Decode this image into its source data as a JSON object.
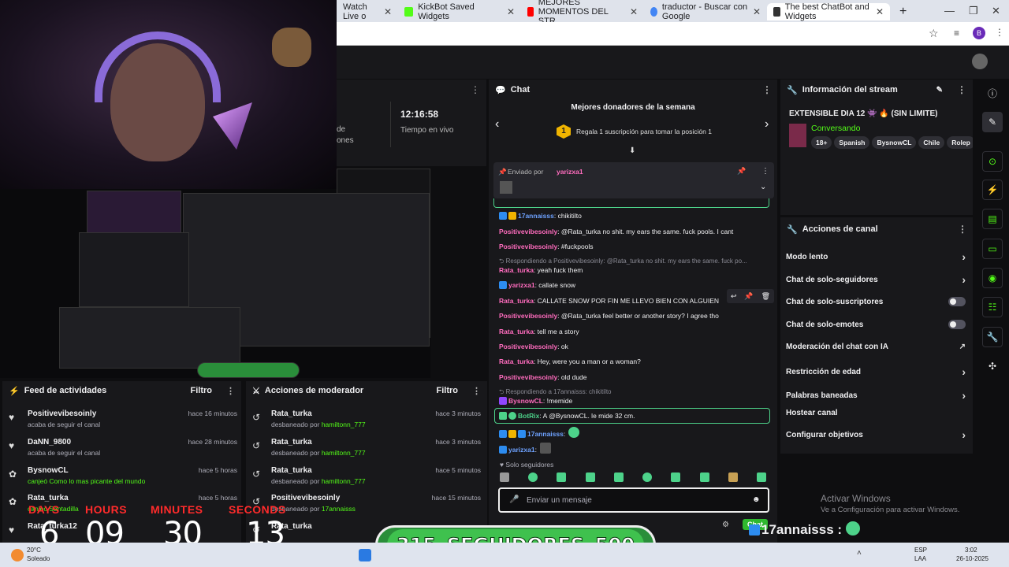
{
  "browser": {
    "tabs": [
      {
        "label": "Watch Live o",
        "color": "#9146ff"
      },
      {
        "label": "KickBot Saved Widgets",
        "color": "#53fc18"
      },
      {
        "label": "MEJORES MOMENTOS DEL STR",
        "color": "#ff0000"
      },
      {
        "label": "traductor - Buscar con Google",
        "color": "#4285f4"
      },
      {
        "label": "The best ChatBot and Widgets",
        "color": "#333333"
      }
    ],
    "new_tab": "+",
    "profile_initial": "B"
  },
  "stats": {
    "time_value": "12:16:58",
    "time_label": "Tiempo en vivo",
    "partial1": "de",
    "partial2": "ones"
  },
  "chat": {
    "title": "Chat",
    "donors_title": "Mejores donadores de la semana",
    "donors_rank": "1",
    "donors_cta": "Regala 1 suscripción para tomar la posición 1",
    "pinned_label": "Enviado por",
    "pinned_user": "yarizxa1",
    "messages": [
      {
        "user": "17annaisss",
        "text": ": chikitilto",
        "color": "blue"
      },
      {
        "user": "Positivevibesoinly",
        "text": ": @Rata_turka no shit. my ears the same. fuck pools. I cant",
        "color": "pink"
      },
      {
        "user": "Positivevibesoinly",
        "text": ": #fuckpools",
        "color": "pink"
      },
      {
        "reply": "Respondiendo a Positivevibesoinly: @Rata_turka no shit. my ears the same. fuck po..."
      },
      {
        "user": "Rata_turka",
        "text": ": yeah fuck them",
        "color": "pink"
      },
      {
        "user": "yarizxa1",
        "text": ": callate snow",
        "color": "pink"
      },
      {
        "user": "Rata_turka",
        "text": ": CALLATE SNOW POR FIN ME LLEVO BIEN CON ALGUIEN",
        "color": "pink"
      },
      {
        "user": "Positivevibesoinly",
        "text": ": @Rata_turka feel better or another story? I agree tho",
        "color": "pink"
      },
      {
        "user": "Rata_turka",
        "text": ": tell me a story",
        "color": "pink"
      },
      {
        "user": "Positivevibesoinly",
        "text": ": ok",
        "color": "pink"
      },
      {
        "user": "Rata_turka",
        "text": ": Hey, were you a man or a woman?",
        "color": "pink"
      },
      {
        "user": "Positivevibesoinly",
        "text": ": old dude",
        "color": "pink"
      },
      {
        "reply": "Respondiendo a 17annaisss: chikitilto"
      },
      {
        "user": "BysnowCL",
        "text": ": !memide",
        "color": "pink"
      },
      {
        "user": "BotRix",
        "text": ": A @BysnowCL. le mide 32 cm.",
        "color": "green"
      },
      {
        "user": "17annaisss",
        "text": ":",
        "color": "blue"
      },
      {
        "user": "yarizxa1",
        "text": ":",
        "color": "blue"
      }
    ],
    "mode_label": "Solo seguidores",
    "input_placeholder": "Enviar un mensaje",
    "send_label": "Chat"
  },
  "info": {
    "title": "Información del stream",
    "stream_title": "EXTENSIBLE DIA 12 👾 🔥 (SIN LIMITE)",
    "category": "Conversando",
    "tags": [
      "18+",
      "Spanish",
      "BysnowCL",
      "Chile",
      "Rolep"
    ]
  },
  "actions": {
    "title": "Acciones de canal",
    "items": [
      {
        "label": "Modo lento",
        "kind": "arrow"
      },
      {
        "label": "Chat de solo-seguidores",
        "kind": "arrow"
      },
      {
        "label": "Chat de solo-suscriptores",
        "kind": "toggle"
      },
      {
        "label": "Chat de solo-emotes",
        "kind": "toggle"
      },
      {
        "label": "Moderación del chat con IA",
        "kind": "external"
      },
      {
        "label": "Restricción de edad",
        "kind": "arrow"
      },
      {
        "label": "Palabras baneadas",
        "kind": "arrow"
      },
      {
        "label": "Hostear canal",
        "kind": "none"
      },
      {
        "label": "Configurar objetivos",
        "kind": "arrow"
      }
    ]
  },
  "feed": {
    "title": "Feed de actividades",
    "filter": "Filtro",
    "items": [
      {
        "name": "Positivevibesoinly",
        "sub": "acaba de seguir el canal",
        "time": "hace 16 minutos",
        "icon": "heart"
      },
      {
        "name": "DaNN_9800",
        "sub": "acaba de seguir el canal",
        "time": "hace 28 minutos",
        "icon": "heart"
      },
      {
        "name": "BysnowCL",
        "sub": "canjeó Como lo mas picante del mundo",
        "time": "hace 5 horas",
        "icon": "reward"
      },
      {
        "name": "Rata_turka",
        "sub": "canjeó Santadilla",
        "time": "hace 5 horas",
        "icon": "reward"
      },
      {
        "name": "Rata_turka12",
        "sub": "",
        "time": "",
        "icon": "heart"
      }
    ]
  },
  "modactions": {
    "title": "Acciones de moderador",
    "filter": "Filtro",
    "items": [
      {
        "name": "Rata_turka",
        "sub": "desbaneado por",
        "by": "hamiltonn_777",
        "time": "hace 3 minutos"
      },
      {
        "name": "Rata_turka",
        "sub": "desbaneado por",
        "by": "hamiltonn_777",
        "time": "hace 3 minutos"
      },
      {
        "name": "Rata_turka",
        "sub": "desbaneado por",
        "by": "hamiltonn_777",
        "time": "hace 5 minutos"
      },
      {
        "name": "Positivevibesoinly",
        "sub": "desbaneado por",
        "by": "17annaisss",
        "time": "hace 15 minutos"
      },
      {
        "name": "Rata_turka",
        "sub": "",
        "by": "",
        "time": ""
      }
    ]
  },
  "timer": {
    "labels": [
      "DAYS",
      "HOURS",
      "MINUTES",
      "SECONDS"
    ],
    "values": [
      "6",
      "09",
      "30",
      "13"
    ]
  },
  "followers_goal": {
    "current": "315",
    "label": "SEGUIDORES",
    "target": "500"
  },
  "overlay_chat": {
    "user": "17annaisss",
    "user2": "yarizxa1"
  },
  "watermark": {
    "line1": "Activar Windows",
    "line2": "Ve a Configuración para activar Windows."
  },
  "taskbar": {
    "weather_temp": "20°C",
    "weather_desc": "Soleado",
    "lang1": "ESP",
    "lang2": "LAA",
    "time": "3:02",
    "date": "26-10-2025"
  },
  "colors": {
    "accent": "#53fc18",
    "twitch_purple": "#9146ff"
  }
}
